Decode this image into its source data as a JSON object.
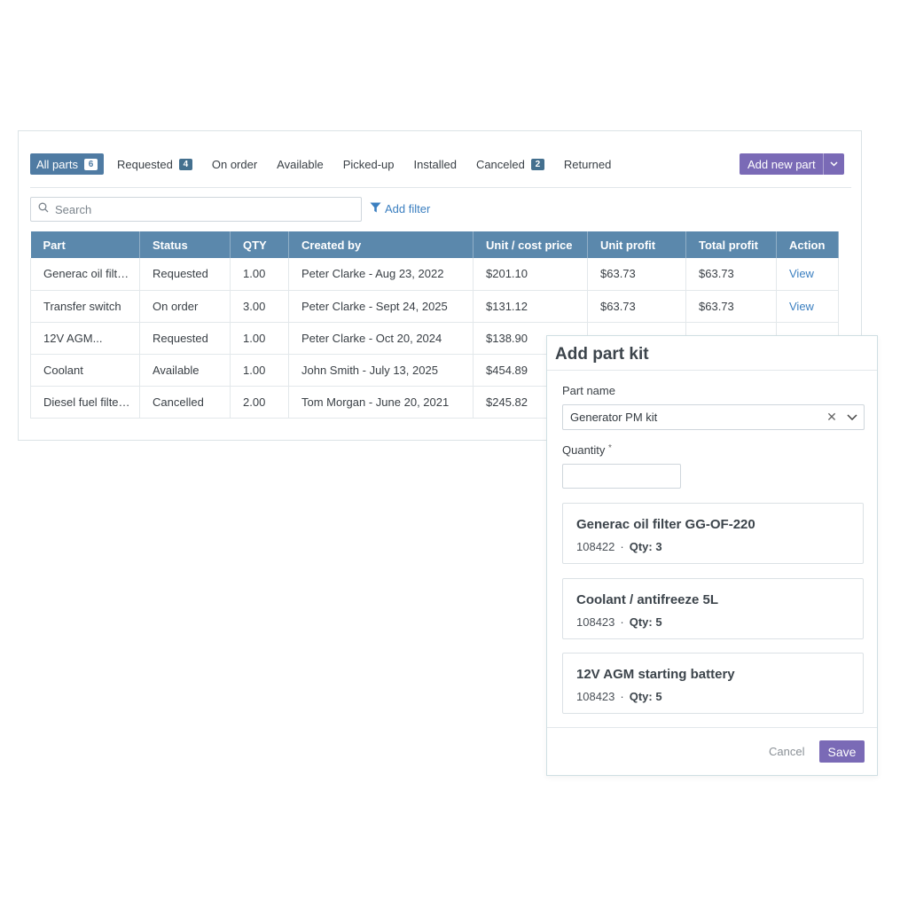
{
  "colors": {
    "accent": "#7a6ab6",
    "header": "#5b88ac",
    "link": "#3b7fc0",
    "active_tab": "#4f7ba3"
  },
  "tabs": [
    {
      "label": "All parts",
      "badge": "6",
      "active": true
    },
    {
      "label": "Requested",
      "badge": "4"
    },
    {
      "label": "On order"
    },
    {
      "label": "Available"
    },
    {
      "label": "Picked-up"
    },
    {
      "label": "Installed"
    },
    {
      "label": "Canceled",
      "badge": "2"
    },
    {
      "label": "Returned"
    }
  ],
  "toolbar": {
    "add_new_part": "Add new part"
  },
  "search": {
    "placeholder": "Search",
    "icon": "search-icon"
  },
  "filter": {
    "label": "Add filter",
    "icon": "filter-icon"
  },
  "table": {
    "columns": [
      "Part",
      "Status",
      "QTY",
      "Created by",
      "Unit / cost price",
      "Unit profit",
      "Total profit",
      "Action"
    ],
    "rows": [
      [
        "Generac oil filt…",
        "Requested",
        "1.00",
        "Peter Clarke - Aug 23, 2022",
        "$201.10",
        "$63.73",
        "$63.73",
        "View"
      ],
      [
        "Transfer switch",
        "On order",
        "3.00",
        "Peter Clarke - Sept 24, 2025",
        "$131.12",
        "$63.73",
        "$63.73",
        "View"
      ],
      [
        "12V AGM...",
        "Requested",
        "1.00",
        "Peter Clarke - Oct 20, 2024",
        "$138.90",
        "",
        "",
        ""
      ],
      [
        "Coolant",
        "Available",
        "1.00",
        "John Smith - July 13, 2025",
        "$454.89",
        "",
        "",
        ""
      ],
      [
        "Diesel fuel filte…",
        "Cancelled",
        "2.00",
        "Tom Morgan - June 20, 2021",
        "$245.82",
        "",
        "",
        ""
      ]
    ]
  },
  "modal": {
    "title": "Add part kit",
    "part_name_label": "Part name",
    "part_name_value": "Generator PM kit",
    "quantity_label": "Quantity",
    "quantity_required": "*",
    "quantity_value": "",
    "kits": [
      {
        "name": "Generac oil filter GG-OF-220",
        "sku": "108422",
        "sep": "·",
        "qty": "Qty: 3"
      },
      {
        "name": "Coolant / antifreeze 5L",
        "sku": "108423",
        "sep": "·",
        "qty": "Qty: 5"
      },
      {
        "name": "12V AGM starting battery",
        "sku": "108423",
        "sep": "·",
        "qty": "Qty: 5"
      }
    ],
    "cancel": "Cancel",
    "save": "Save"
  }
}
